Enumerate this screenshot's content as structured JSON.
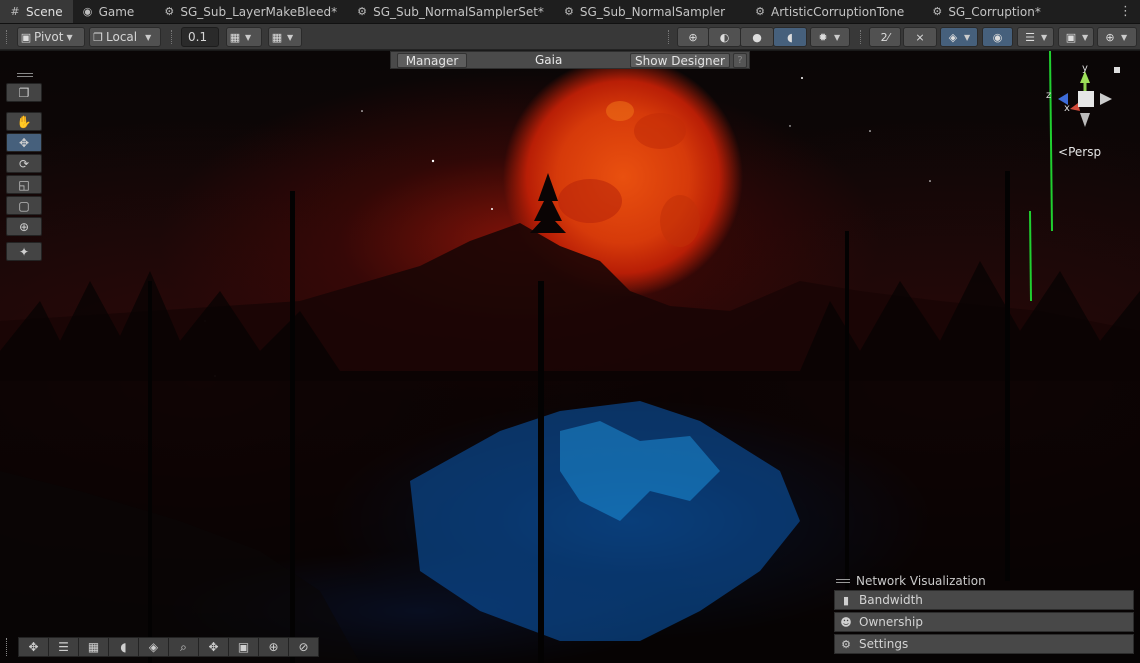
{
  "tabs": [
    {
      "label": "Scene",
      "icon": "scene-grid-icon",
      "active": true
    },
    {
      "label": "Game",
      "icon": "gamepad-icon",
      "active": false
    },
    {
      "label": "SG_Sub_LayerMakeBleed*",
      "icon": "shader-graph-icon",
      "active": false
    },
    {
      "label": "SG_Sub_NormalSamplerSet*",
      "icon": "shader-graph-icon",
      "active": false
    },
    {
      "label": "SG_Sub_NormalSampler",
      "icon": "shader-graph-icon",
      "active": false
    },
    {
      "label": "ArtisticCorruptionTone",
      "icon": "shader-graph-icon",
      "active": false
    },
    {
      "label": "SG_Corruption*",
      "icon": "shader-graph-icon",
      "active": false
    }
  ],
  "toolbar": {
    "pivot_label": "Pivot",
    "space_label": "Local",
    "snap_value": "0.1"
  },
  "overlay": {
    "manager_label": "Manager",
    "title": "Gaia",
    "show_designer_label": "Show Designer",
    "help_label": "?"
  },
  "gizmo": {
    "y_label": "y",
    "x_label": "x",
    "z_label": "z",
    "projection_label": "Persp"
  },
  "network_panel": {
    "title": "Network Visualization",
    "rows": [
      {
        "label": "Bandwidth",
        "icon": "bar-chart-icon"
      },
      {
        "label": "Ownership",
        "icon": "user-circle-icon"
      },
      {
        "label": "Settings",
        "icon": "gear-icon"
      }
    ]
  },
  "colors": {
    "active_tool": "#46607c",
    "moon": "#e2470e",
    "ice_blue": "#0a82e6"
  }
}
